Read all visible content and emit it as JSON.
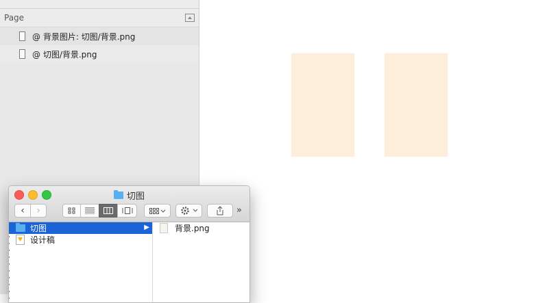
{
  "sidebar": {
    "section_title": "Page",
    "layers": [
      {
        "label": "@ 背景图片: 切图/背景.png"
      },
      {
        "label": "@ 切图/背景.png"
      }
    ]
  },
  "canvas": {
    "artboard_color": "#fdeedc"
  },
  "finder": {
    "title": "切图",
    "toolbar": {
      "back_label": "‹",
      "forward_label": "›",
      "more_label": "»"
    },
    "column1": [
      {
        "label": "切图",
        "selected": true
      },
      {
        "label": "设计稿",
        "selected": false
      }
    ],
    "column2": [
      {
        "label": "背景.png"
      }
    ]
  }
}
